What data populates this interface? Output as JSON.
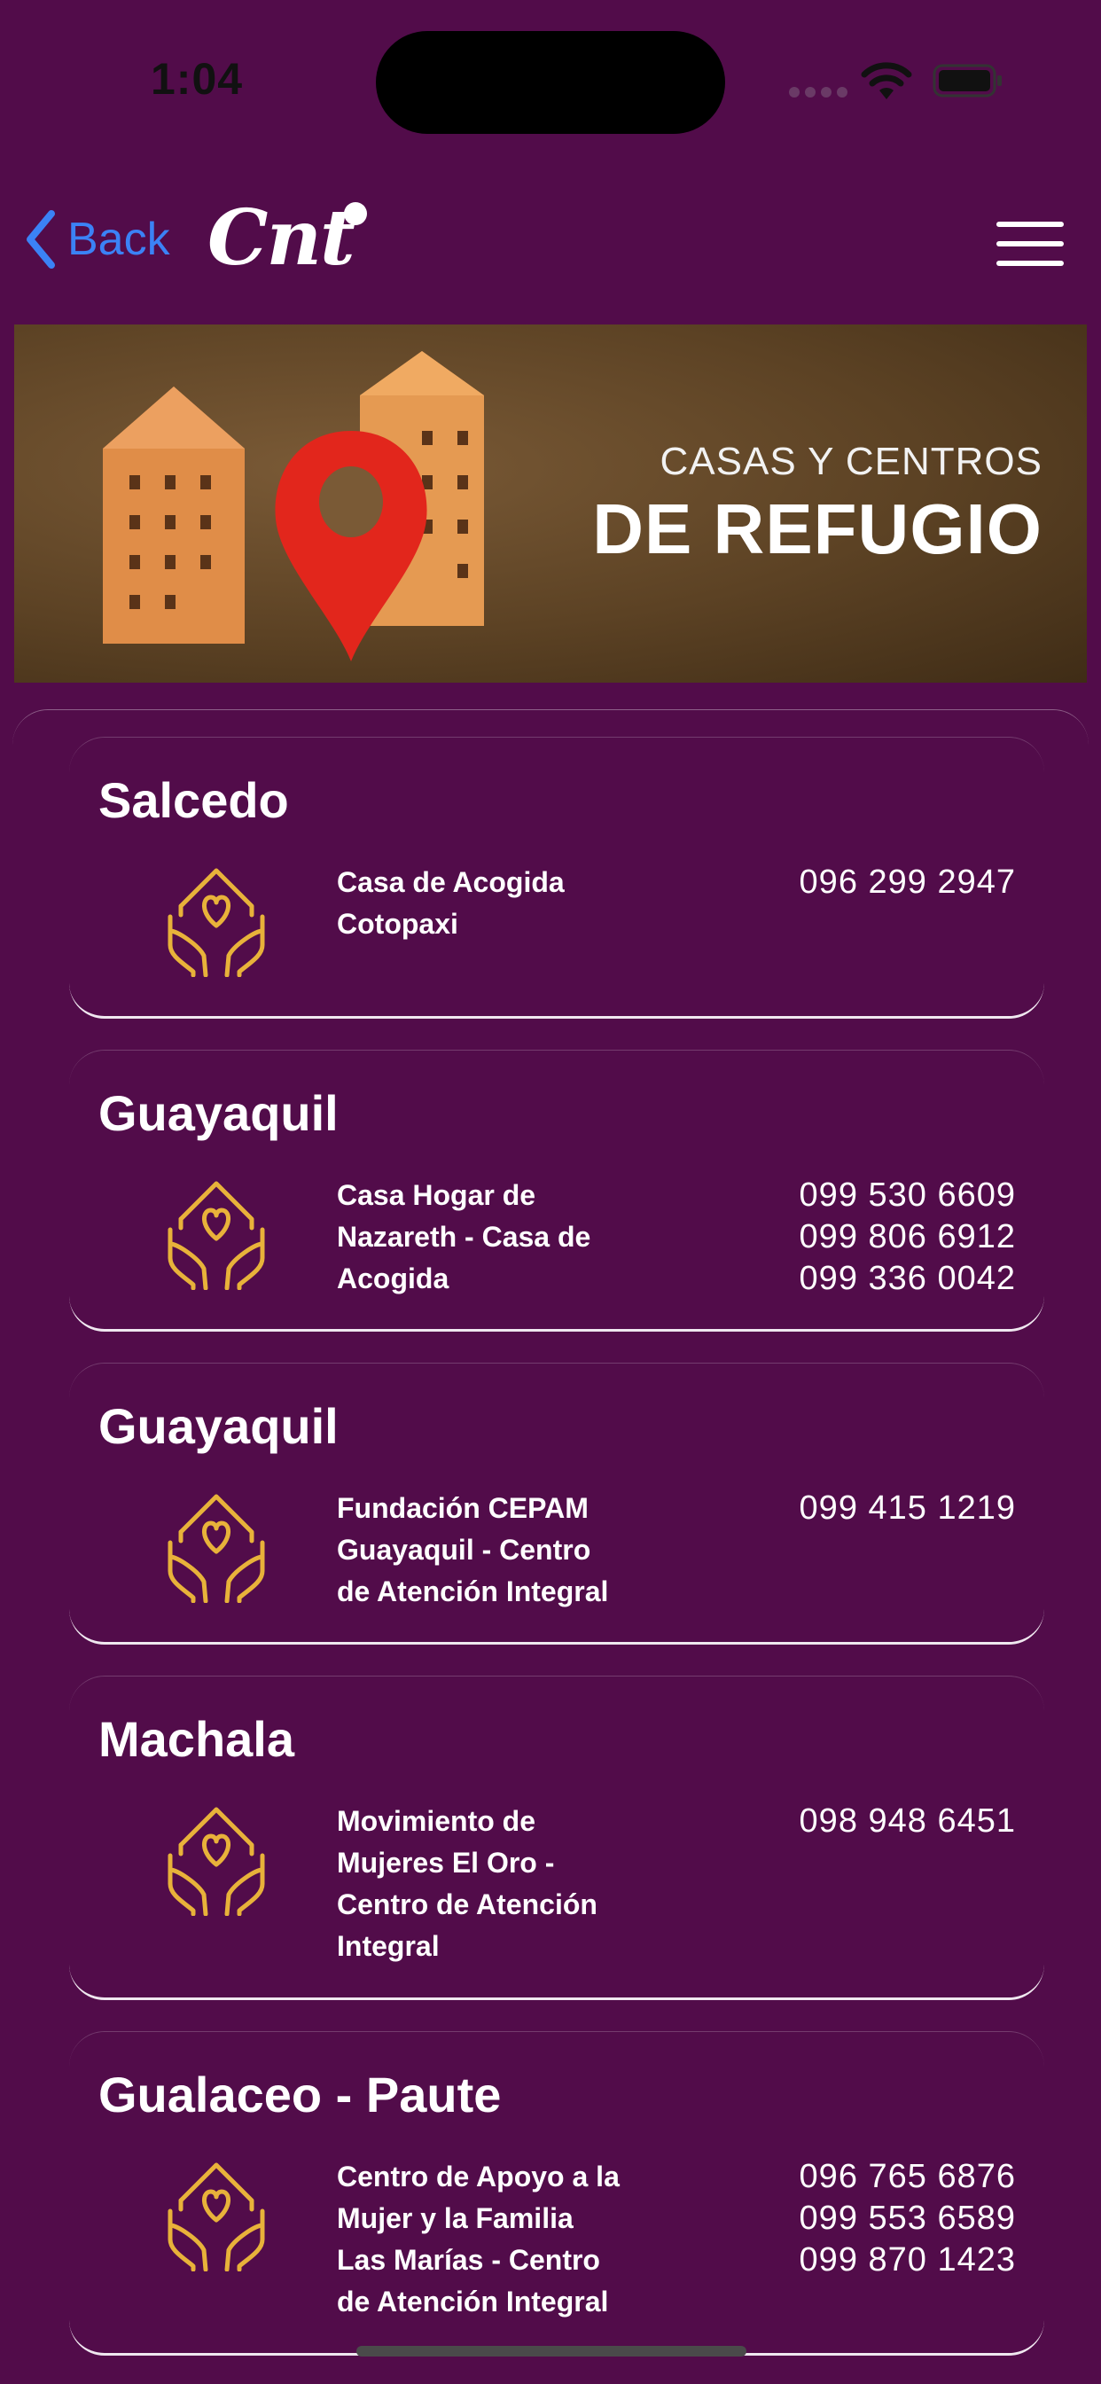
{
  "status_bar": {
    "time": "1:04"
  },
  "nav": {
    "back_label": "Back",
    "logo_text": "Cnt"
  },
  "banner": {
    "line1": "CASAS Y CENTROS",
    "line2": "DE REFUGIO"
  },
  "colors": {
    "background": "#520c4a",
    "accent_blue": "#3b82f6",
    "icon_gold": "#e8b23a"
  },
  "shelters": [
    {
      "city": "Salcedo",
      "name_lines": [
        "Casa de Acogida",
        "Cotopaxi"
      ],
      "phones": [
        "096 299 2947"
      ]
    },
    {
      "city": "Guayaquil",
      "name_lines": [
        "Casa Hogar de",
        "Nazareth - Casa de",
        "Acogida"
      ],
      "phones": [
        "099 530 6609",
        "099 806 6912",
        "099 336 0042"
      ]
    },
    {
      "city": "Guayaquil",
      "name_lines": [
        "Fundación CEPAM",
        "Guayaquil - Centro",
        "de Atención Integral"
      ],
      "phones": [
        "099 415 1219"
      ]
    },
    {
      "city": "Machala",
      "name_lines": [
        "Movimiento de",
        "Mujeres El Oro -",
        "Centro de Atención",
        "Integral"
      ],
      "phones": [
        "098 948 6451"
      ]
    },
    {
      "city": "Gualaceo - Paute",
      "name_lines": [
        "Centro de Apoyo a la",
        "Mujer y la Familia",
        "Las Marías - Centro",
        "de Atención Integral"
      ],
      "phones": [
        "096 765 6876",
        "099 553 6589",
        "099 870 1423"
      ]
    }
  ]
}
